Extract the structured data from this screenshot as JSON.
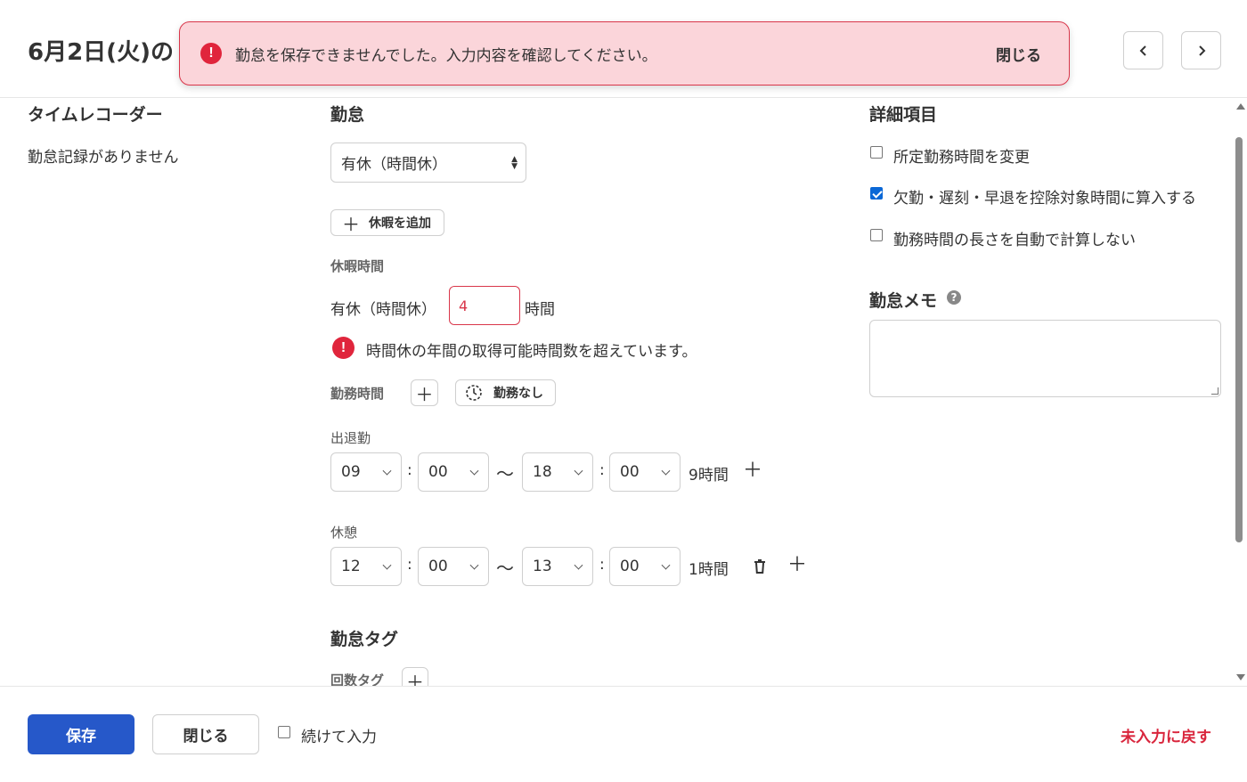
{
  "header": {
    "title": "6月2日(火)の",
    "prev_icon": "chevron-left-icon",
    "next_icon": "chevron-right-icon"
  },
  "toast": {
    "message": "勤怠を保存できませんでした。入力内容を確認してください。",
    "close_label": "閉じる",
    "icon": "!"
  },
  "left": {
    "title": "タイムレコーダー",
    "empty_text": "勤怠記録がありません"
  },
  "attendance": {
    "title": "勤怠",
    "type_select": "有休（時間休）",
    "add_leave_label": "休暇を追加",
    "leave_time_label": "休暇時間",
    "leave_type_label": "有休（時間休）",
    "leave_hours_value": "4",
    "hours_unit": "時間",
    "error_icon": "!",
    "error_message": "時間休の年間の取得可能時間数を超えています。",
    "work_time_label": "勤務時間",
    "no_work_label": "勤務なし",
    "clock_in_out_label": "出退勤",
    "work": {
      "start_h": "09",
      "start_m": "00",
      "end_h": "18",
      "end_m": "00",
      "duration": "9時間"
    },
    "break_label": "休憩",
    "break": {
      "start_h": "12",
      "start_m": "00",
      "end_h": "13",
      "end_m": "00",
      "duration": "1時間"
    },
    "colon": ":",
    "tilde": "〜",
    "tags_title": "勤怠タグ",
    "count_tags_label": "回数タグ"
  },
  "details": {
    "title": "詳細項目",
    "options": [
      {
        "label": "所定勤務時間を変更",
        "checked": false
      },
      {
        "label": "欠勤・遅刻・早退を控除対象時間に算入する",
        "checked": true
      },
      {
        "label": "勤務時間の長さを自動で計算しない",
        "checked": false
      }
    ],
    "memo_title": "勤怠メモ",
    "help_icon": "?"
  },
  "footer": {
    "save_label": "保存",
    "close_label": "閉じる",
    "continue_label": "続けて入力",
    "reset_label": "未入力に戻す"
  },
  "colors": {
    "primary": "#2658c9",
    "error": "#d9253c",
    "toast_bg": "#fbd5da"
  }
}
